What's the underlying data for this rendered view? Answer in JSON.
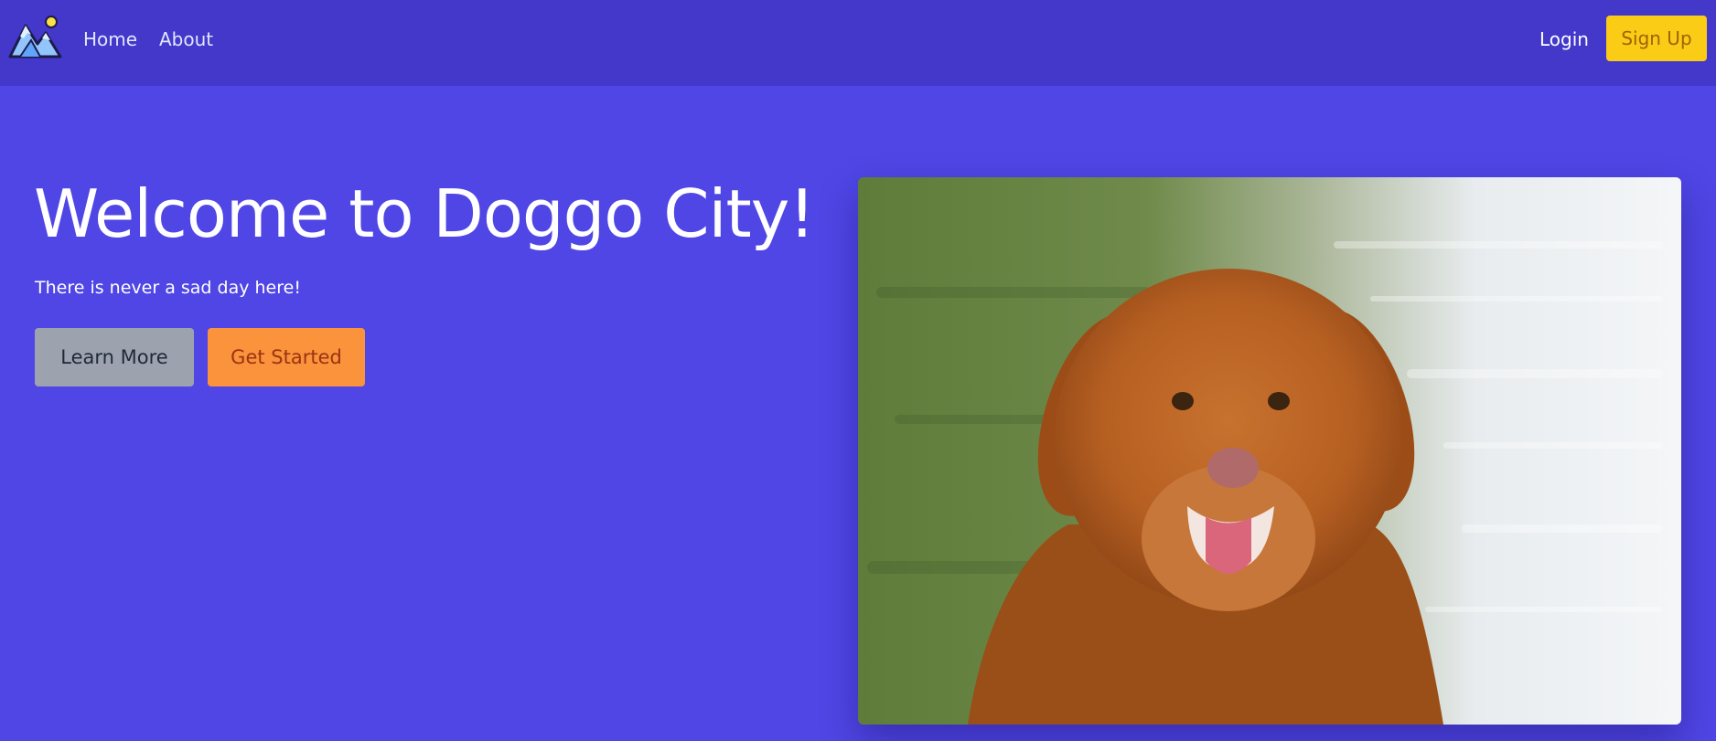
{
  "nav": {
    "logo_icon": "mountain-sun-logo-icon",
    "links": [
      "Home",
      "About"
    ],
    "login_label": "Login",
    "signup_label": "Sign Up"
  },
  "hero": {
    "title": "Welcome to Doggo City!",
    "subtitle": "There is never a sad day here!",
    "learn_more_label": "Learn More",
    "get_started_label": "Get Started",
    "image_icon": "dog-photo-image"
  },
  "colors": {
    "page_bg": "#4f46e5",
    "navbar_bg": "#4338ca",
    "signup_bg": "#facc15",
    "learn_more_bg": "#9ca3af",
    "get_started_bg": "#fb923c"
  }
}
